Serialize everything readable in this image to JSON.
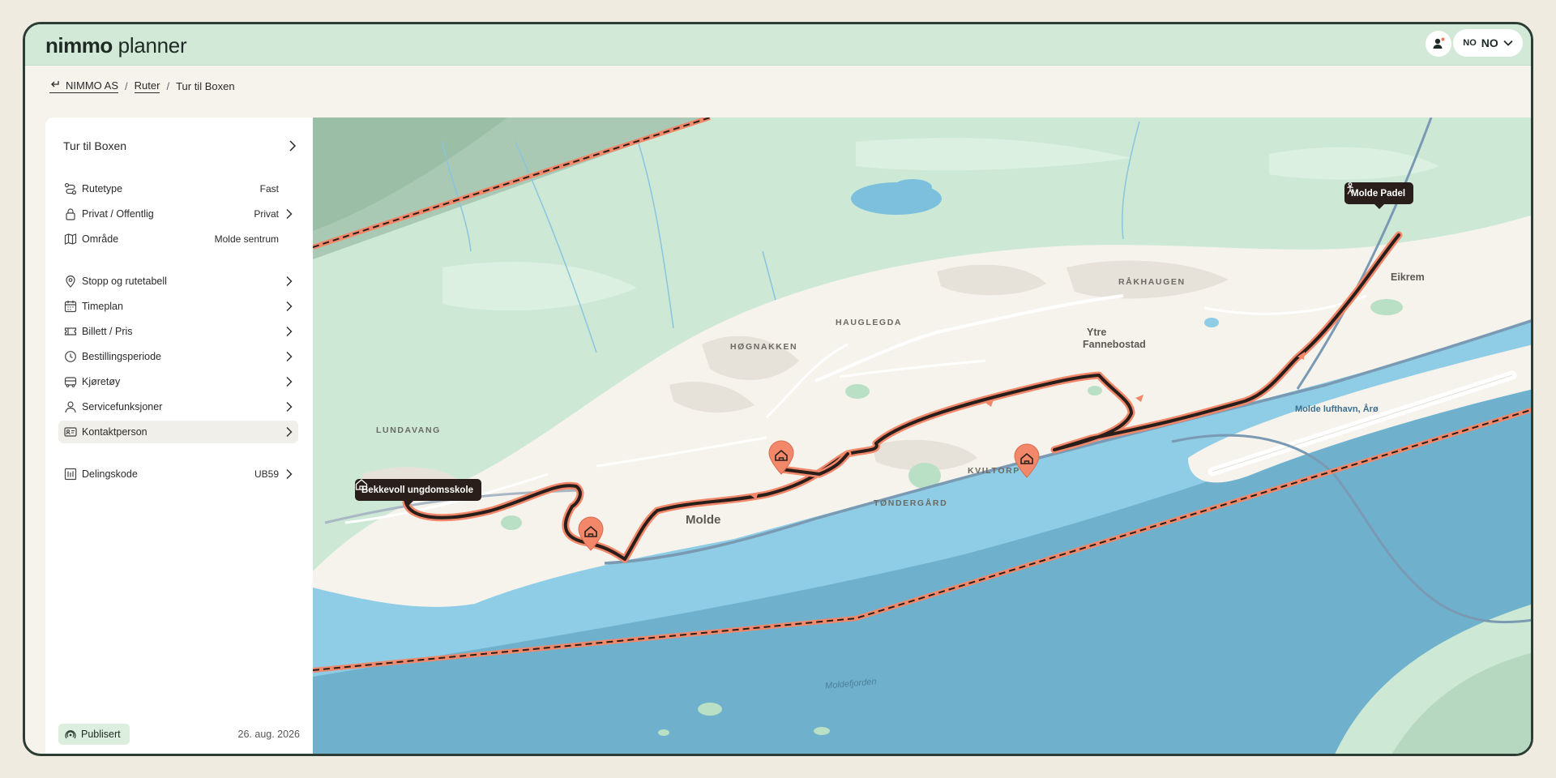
{
  "app": {
    "logo_bold": "nimmo",
    "logo_light": "planner"
  },
  "header": {
    "lang_small": "NO",
    "lang_big": "NO"
  },
  "breadcrumb": {
    "items": [
      "NIMMO AS",
      "Ruter",
      "Tur til Boxen"
    ]
  },
  "sidebar": {
    "title": "Tur til Boxen",
    "properties": [
      {
        "label": "Rutetype",
        "value": "Fast",
        "icon": "route-icon"
      },
      {
        "label": "Privat / Offentlig",
        "value": "Privat",
        "icon": "lock-icon"
      },
      {
        "label": "Område",
        "value": "Molde sentrum",
        "icon": "map-icon"
      }
    ],
    "sections": [
      {
        "label": "Stopp og rutetabell",
        "icon": "location-pin-icon"
      },
      {
        "label": "Timeplan",
        "icon": "calendar-icon"
      },
      {
        "label": "Billett / Pris",
        "icon": "ticket-icon"
      },
      {
        "label": "Bestillingsperiode",
        "icon": "clock-icon"
      },
      {
        "label": "Kjøretøy",
        "icon": "bus-icon"
      },
      {
        "label": "Servicefunksjoner",
        "icon": "person-icon"
      },
      {
        "label": "Kontaktperson",
        "icon": "contact-card-icon"
      }
    ],
    "share": {
      "label": "Delingskode",
      "value": "UB59",
      "icon": "share-code-icon"
    },
    "status": "Publisert",
    "date": "26. aug. 2026"
  },
  "map": {
    "labels": [
      "LUNDAVANG",
      "HØGNAKKEN",
      "HAUGLEGDA",
      "RÅKHAUGEN",
      "KVILTORP",
      "TØNDERGÅRD"
    ],
    "places": [
      "Molde",
      "Ytre",
      "Fannebostad",
      "Eikrem"
    ],
    "airport": "Molde lufthavn, Årø",
    "water": "Moldefjorden",
    "start_stop": "Bekkevoll ungdomsskole",
    "end_stop": "Molde Padel"
  },
  "colors": {
    "route_outer": "#f2876a",
    "route_inner": "#2a1e1a",
    "water": "#8ecde5",
    "land": "#f6f3ed",
    "green": "#cde9d6"
  }
}
